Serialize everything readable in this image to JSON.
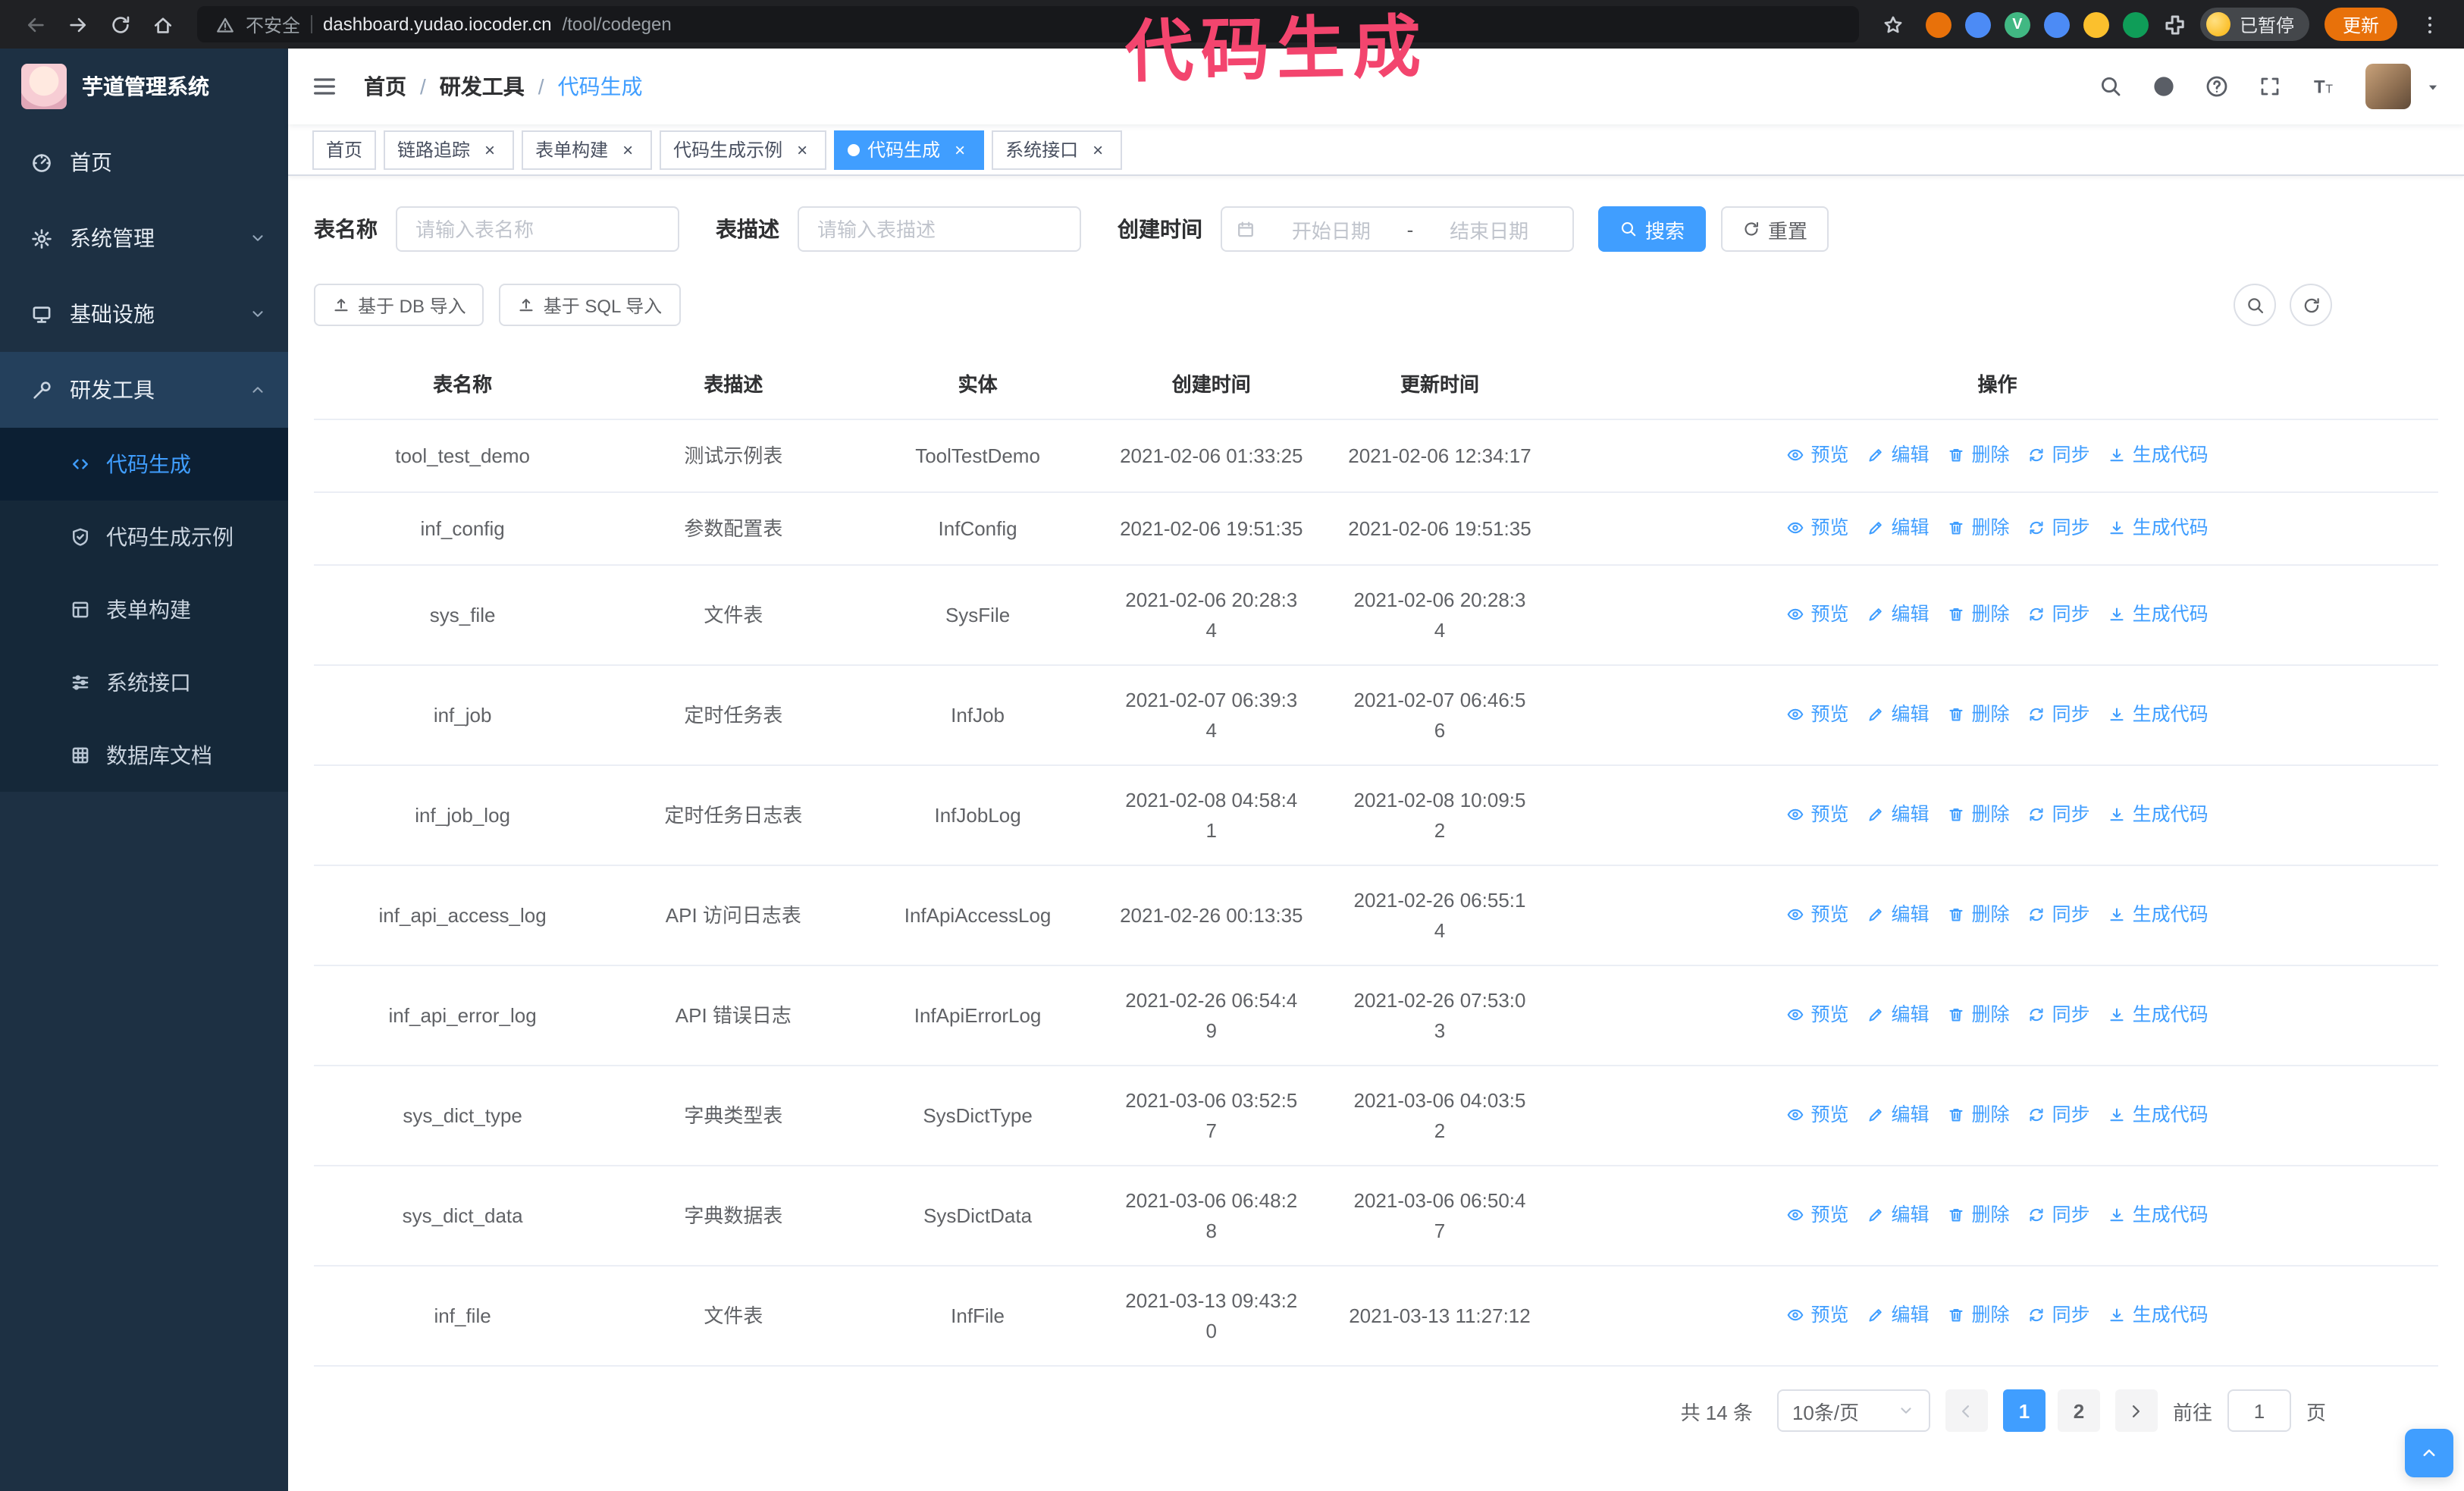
{
  "theme": {
    "primary": "#409eff",
    "sidebar_bg": "#1d3043",
    "sidebar_submenu_bg": "#152839",
    "annotation_color": "#f3456e",
    "update_button_color": "#e8710a"
  },
  "browser": {
    "security_label": "不安全",
    "url_host": "dashboard.yudao.iocoder.cn",
    "url_path": "/tool/codegen",
    "paused_badge": "已暂停",
    "update_button": "更新",
    "extensions": [
      {
        "name": "extension-orange",
        "color": "#e8710a"
      },
      {
        "name": "extension-blue",
        "color": "#4c8bf5"
      },
      {
        "name": "extension-vue-devtools",
        "color": "#41b883",
        "letter": "V"
      },
      {
        "name": "extension-blue-people",
        "color": "#4c8bf5"
      },
      {
        "name": "extension-yellow",
        "color": "#fbc02d"
      },
      {
        "name": "extension-green",
        "color": "#0f9d58"
      },
      {
        "name": "extensions-menu",
        "puzzle": true,
        "color": "#c7cbd1"
      }
    ]
  },
  "annotation": {
    "text": "代码生成",
    "color": "#f3456e"
  },
  "sidebar": {
    "logo_title": "芋道管理系统",
    "items": [
      {
        "id": "home",
        "label": "首页",
        "icon": "dashboard-icon"
      },
      {
        "id": "system",
        "label": "系统管理",
        "icon": "gear-icon",
        "expandable": true
      },
      {
        "id": "infra",
        "label": "基础设施",
        "icon": "infra-icon",
        "expandable": true
      },
      {
        "id": "devtools",
        "label": "研发工具",
        "icon": "tools-icon",
        "expandable": true,
        "expanded": true,
        "children": [
          {
            "id": "codegen",
            "label": "代码生成",
            "icon": "code-icon",
            "active": true
          },
          {
            "id": "codegen-example",
            "label": "代码生成示例",
            "icon": "example-icon"
          },
          {
            "id": "form-builder",
            "label": "表单构建",
            "icon": "form-icon"
          },
          {
            "id": "system-api",
            "label": "系统接口",
            "icon": "api-icon"
          },
          {
            "id": "db-doc",
            "label": "数据库文档",
            "icon": "dbdoc-icon"
          }
        ]
      }
    ]
  },
  "header": {
    "breadcrumb": [
      "首页",
      "研发工具",
      "代码生成"
    ],
    "separator": "/"
  },
  "tabs": [
    {
      "id": "home",
      "label": "首页",
      "closable": false
    },
    {
      "id": "tracer",
      "label": "链路追踪",
      "closable": true
    },
    {
      "id": "form-builder",
      "label": "表单构建",
      "closable": true
    },
    {
      "id": "codegen-example",
      "label": "代码生成示例",
      "closable": true
    },
    {
      "id": "codegen",
      "label": "代码生成",
      "closable": true,
      "active": true
    },
    {
      "id": "system-api",
      "label": "系统接口",
      "closable": true
    }
  ],
  "filters": {
    "table_name_label": "表名称",
    "table_name_placeholder": "请输入表名称",
    "table_desc_label": "表描述",
    "table_desc_placeholder": "请输入表描述",
    "create_time_label": "创建时间",
    "date_start_placeholder": "开始日期",
    "date_separator": "-",
    "date_end_placeholder": "结束日期",
    "search_button": "搜索",
    "reset_button": "重置"
  },
  "toolbar": {
    "import_db_label": "基于 DB 导入",
    "import_sql_label": "基于 SQL 导入"
  },
  "table": {
    "columns": [
      "表名称",
      "表描述",
      "实体",
      "创建时间",
      "更新时间",
      "操作"
    ],
    "actions": [
      {
        "id": "preview",
        "label": "预览",
        "icon": "eye-icon"
      },
      {
        "id": "edit",
        "label": "编辑",
        "icon": "edit-icon"
      },
      {
        "id": "delete",
        "label": "删除",
        "icon": "delete-icon"
      },
      {
        "id": "sync",
        "label": "同步",
        "icon": "sync-icon"
      },
      {
        "id": "generate",
        "label": "生成代码",
        "icon": "download-icon"
      }
    ],
    "rows": [
      {
        "name": "tool_test_demo",
        "desc": "测试示例表",
        "entity": "ToolTestDemo",
        "created": "2021-02-06 01:33:25",
        "updated": "2021-02-06 12:34:17"
      },
      {
        "name": "inf_config",
        "desc": "参数配置表",
        "entity": "InfConfig",
        "created": "2021-02-06 19:51:35",
        "updated": "2021-02-06 19:51:35"
      },
      {
        "name": "sys_file",
        "desc": "文件表",
        "entity": "SysFile",
        "created": "2021-02-06 20:28:3\n4",
        "updated": "2021-02-06 20:28:3\n4"
      },
      {
        "name": "inf_job",
        "desc": "定时任务表",
        "entity": "InfJob",
        "created": "2021-02-07 06:39:3\n4",
        "updated": "2021-02-07 06:46:5\n6"
      },
      {
        "name": "inf_job_log",
        "desc": "定时任务日志表",
        "entity": "InfJobLog",
        "created": "2021-02-08 04:58:4\n1",
        "updated": "2021-02-08 10:09:5\n2"
      },
      {
        "name": "inf_api_access_log",
        "desc": "API 访问日志表",
        "entity": "InfApiAccessLog",
        "created": "2021-02-26 00:13:35",
        "updated": "2021-02-26 06:55:1\n4"
      },
      {
        "name": "inf_api_error_log",
        "desc": "API 错误日志",
        "entity": "InfApiErrorLog",
        "created": "2021-02-26 06:54:4\n9",
        "updated": "2021-02-26 07:53:0\n3"
      },
      {
        "name": "sys_dict_type",
        "desc": "字典类型表",
        "entity": "SysDictType",
        "created": "2021-03-06 03:52:5\n7",
        "updated": "2021-03-06 04:03:5\n2"
      },
      {
        "name": "sys_dict_data",
        "desc": "字典数据表",
        "entity": "SysDictData",
        "created": "2021-03-06 06:48:2\n8",
        "updated": "2021-03-06 06:50:4\n7"
      },
      {
        "name": "inf_file",
        "desc": "文件表",
        "entity": "InfFile",
        "created": "2021-03-13 09:43:2\n0",
        "updated": "2021-03-13 11:27:12"
      }
    ]
  },
  "pagination": {
    "total": "共 14 条",
    "page_size": "10条/页",
    "pages": [
      "1",
      "2"
    ],
    "active_page": "1",
    "goto_label": "前往",
    "goto_value": "1",
    "goto_unit": "页"
  }
}
